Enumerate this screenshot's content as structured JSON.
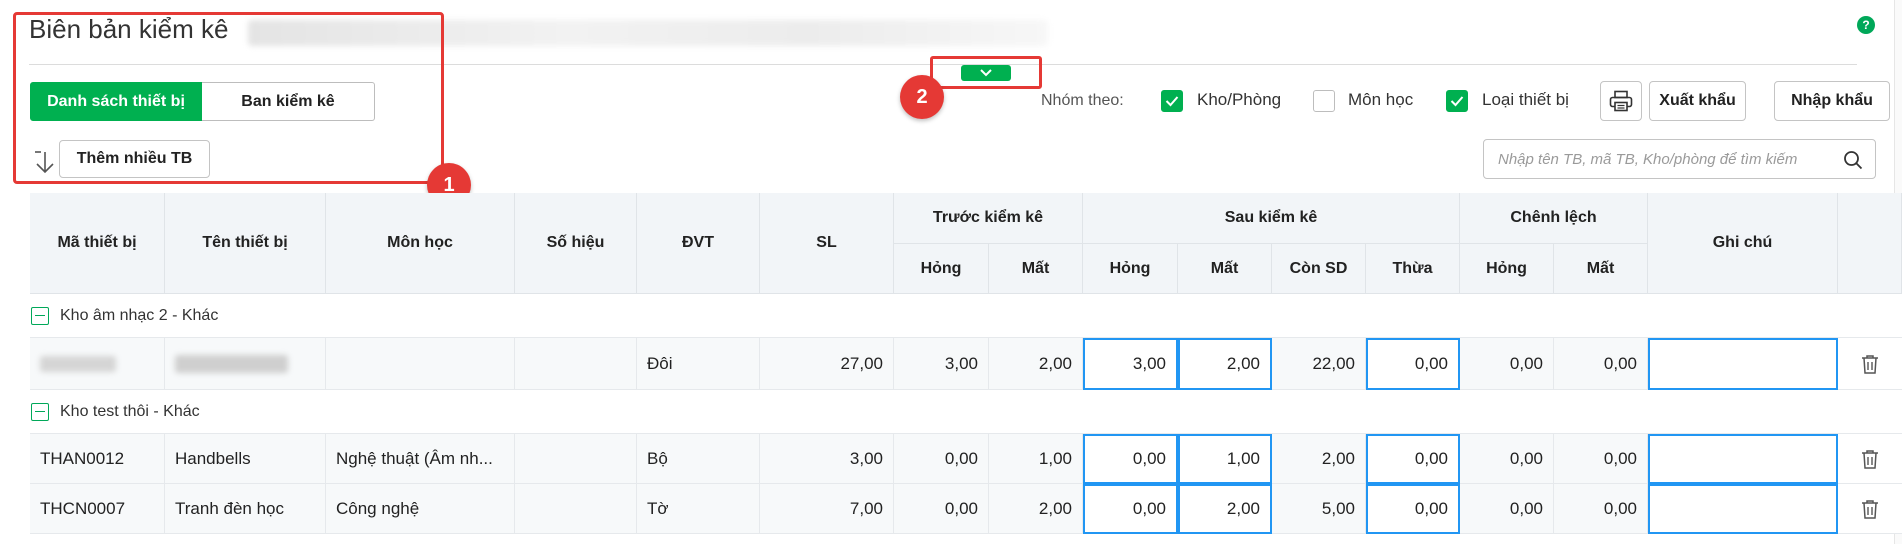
{
  "page": {
    "title": "Biên bản kiểm kê"
  },
  "tabs": [
    {
      "label": "Danh sách thiết bị",
      "active": true
    },
    {
      "label": "Ban kiểm kê",
      "active": false
    }
  ],
  "toolbar": {
    "add_many_label": "Thêm nhiều TB",
    "group_by_label": "Nhóm theo:",
    "group_options": [
      {
        "label": "Kho/Phòng",
        "checked": true
      },
      {
        "label": "Môn học",
        "checked": false
      },
      {
        "label": "Loại thiết bị",
        "checked": true
      }
    ],
    "print_icon": "printer-icon",
    "export_label": "Xuất khẩu",
    "import_label": "Nhập khẩu",
    "search_placeholder": "Nhập tên TB, mã TB, Kho/phòng để tìm kiếm"
  },
  "annotations": {
    "badge1": "1",
    "badge2": "2"
  },
  "colors": {
    "accent": "#00b050",
    "annotation": "#e53935",
    "input_border": "#2196f3"
  },
  "table": {
    "headers": {
      "code": "Mã thiết bị",
      "name": "Tên thiết bị",
      "subject": "Môn học",
      "serial": "Số hiệu",
      "unit": "ĐVT",
      "qty": "SL",
      "before_group": "Trước kiểm kê",
      "after_group": "Sau kiểm kê",
      "diff_group": "Chênh lệch",
      "note": "Ghi chú",
      "broken": "Hỏng",
      "lost": "Mất",
      "in_use": "Còn SD",
      "excess": "Thừa"
    },
    "groups": [
      {
        "label": "Kho âm nhạc 2 - Khác",
        "rows": [
          {
            "code": "",
            "name": "",
            "subject": "",
            "serial": "",
            "unit": "Đôi",
            "qty": "27,00",
            "before_broken": "3,00",
            "before_lost": "2,00",
            "after_broken": "3,00",
            "after_lost": "2,00",
            "after_in_use": "22,00",
            "after_excess": "0,00",
            "diff_broken": "0,00",
            "diff_lost": "0,00",
            "note": "",
            "redacted": true
          }
        ]
      },
      {
        "label": "Kho test thôi - Khác",
        "rows": [
          {
            "code": "THAN0012",
            "name": "Handbells",
            "subject": "Nghệ thuật (Âm nh...",
            "serial": "",
            "unit": "Bộ",
            "qty": "3,00",
            "before_broken": "0,00",
            "before_lost": "1,00",
            "after_broken": "0,00",
            "after_lost": "1,00",
            "after_in_use": "2,00",
            "after_excess": "0,00",
            "diff_broken": "0,00",
            "diff_lost": "0,00",
            "note": "",
            "redacted": false
          },
          {
            "code": "THCN0007",
            "name": "Tranh đèn học",
            "subject": "Công nghệ",
            "serial": "",
            "unit": "Tờ",
            "qty": "7,00",
            "before_broken": "0,00",
            "before_lost": "2,00",
            "after_broken": "0,00",
            "after_lost": "2,00",
            "after_in_use": "5,00",
            "after_excess": "0,00",
            "diff_broken": "0,00",
            "diff_lost": "0,00",
            "note": "",
            "redacted": false
          }
        ]
      }
    ]
  }
}
